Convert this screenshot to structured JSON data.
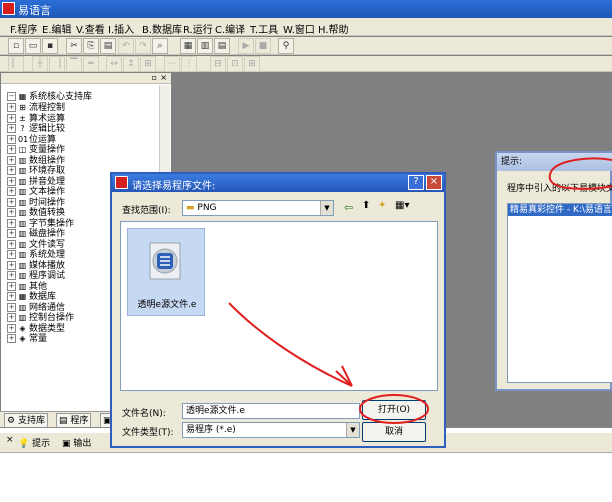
{
  "app": {
    "title": "易语言"
  },
  "menu": [
    "F.程序",
    "E.编辑",
    "V.查看",
    "I.插入",
    "B.数据库",
    "R.运行",
    "C.编译",
    "T.工具",
    "W.窗口",
    "H.帮助"
  ],
  "panel": {
    "tree_root": "系统核心支持库",
    "tree_items": [
      "流程控制",
      "算术运算",
      "逻辑比较",
      "位运算",
      "变量操作",
      "数组操作",
      "环境存取",
      "拼音处理",
      "文本操作",
      "时间操作",
      "数值转换",
      "字节集操作",
      "磁盘操作",
      "文件读写",
      "系统处理",
      "媒体播放",
      "程序调试",
      "其他",
      "数据库",
      "网络通信",
      "控制台操作",
      "数据类型",
      "常量"
    ],
    "tabs": [
      "支持库",
      "程序",
      "属"
    ]
  },
  "bottom": {
    "tabs": [
      "提示",
      "输出"
    ]
  },
  "dialog": {
    "title": "请选择易程序文件:",
    "look_in_label": "查找范围(I):",
    "look_in_value": "PNG",
    "file_item": "透明e源文件.e",
    "filename_label": "文件名(N):",
    "filename_value": "透明e源文件.e",
    "filetype_label": "文件类型(T):",
    "filetype_value": "易程序 (*.e)",
    "open_button": "打开(O)",
    "cancel_button": "取消"
  },
  "hint_window": {
    "title": "提示:",
    "text": "程序中引入的以下易模块文",
    "list_item": "精易真彩控件 - K:\\易语言"
  },
  "colors": {
    "title_blue": "#2a6fd6",
    "dialog_bg": "#ece9d8",
    "annotation_red": "#e02020",
    "selection_blue": "#316ac5"
  }
}
